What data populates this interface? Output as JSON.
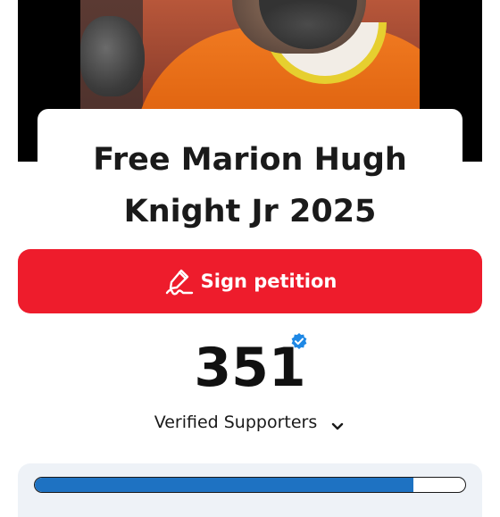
{
  "petition": {
    "title": "Free Marion Hugh Knight Jr 2025",
    "sign_label": "Sign petition",
    "supporter_count": "351",
    "supporters_label": "Verified Supporters",
    "progress_fraction": 0.88
  },
  "icons": {
    "sign": "pen-signature-icon",
    "verified": "verified-badge-icon",
    "expand": "chevron-down-icon"
  },
  "colors": {
    "sign_button": "#ee1c2c",
    "progress_fill": "#1e72c2",
    "verified_badge": "#1e88e5",
    "progress_card": "#eef2f7"
  }
}
